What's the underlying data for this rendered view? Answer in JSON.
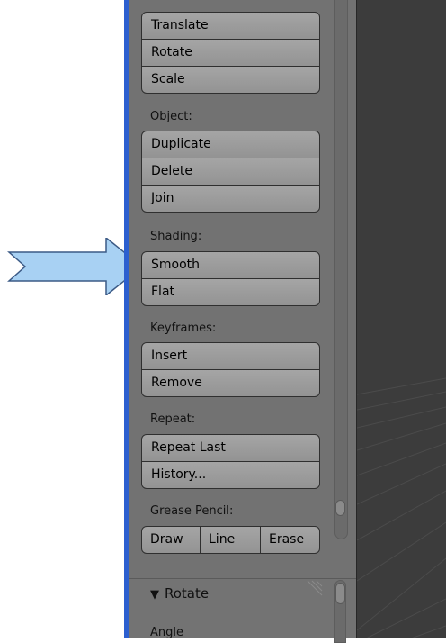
{
  "transform": {
    "buttons": [
      "Translate",
      "Rotate",
      "Scale"
    ]
  },
  "object": {
    "label": "Object:",
    "buttons": [
      "Duplicate",
      "Delete",
      "Join"
    ]
  },
  "shading": {
    "label": "Shading:",
    "buttons": [
      "Smooth",
      "Flat"
    ]
  },
  "keyframes": {
    "label": "Keyframes:",
    "buttons": [
      "Insert",
      "Remove"
    ]
  },
  "repeat": {
    "label": "Repeat:",
    "buttons": [
      "Repeat Last",
      "History..."
    ]
  },
  "grease_pencil": {
    "label": "Grease Pencil:",
    "buttons": [
      "Draw",
      "Line",
      "Erase"
    ]
  },
  "operator_panel": {
    "title": "Rotate",
    "field_label": "Angle",
    "collapse_icon": "triangle-down-icon"
  },
  "colors": {
    "panel_edge": "#2c5fcf",
    "arrow_fill": "#a8d1f3",
    "arrow_stroke": "#3b5a86"
  }
}
